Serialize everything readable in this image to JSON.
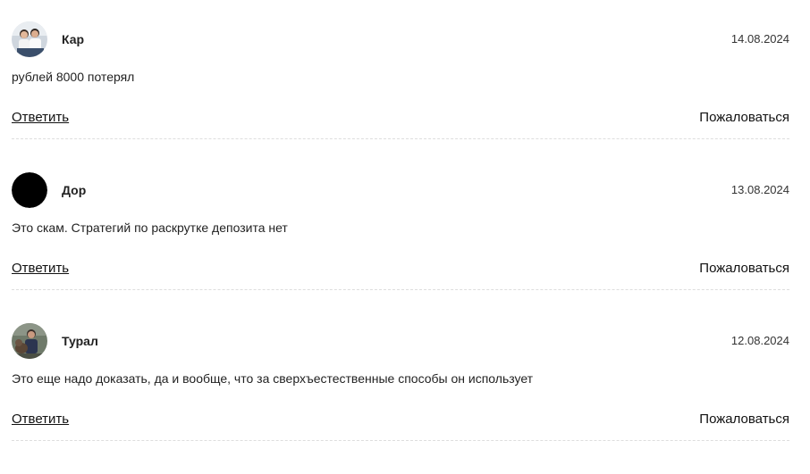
{
  "comments": [
    {
      "author": "Кар",
      "date": "14.08.2024",
      "text": "рублей 8000 потерял",
      "reply_label": "Ответить",
      "report_label": "Пожаловаться",
      "avatar": "photo-avatar-two-people"
    },
    {
      "author": "Дор",
      "date": "13.08.2024",
      "text": "Это скам. Стратегий по раскрутке депозита нет",
      "reply_label": "Ответить",
      "report_label": "Пожаловаться",
      "avatar": "black-circle-avatar"
    },
    {
      "author": "Турал",
      "date": "12.08.2024",
      "text": "Это еще надо доказать, да и вообще, что за сверхъестественные способы он использует",
      "reply_label": "Ответить",
      "report_label": "Пожаловаться",
      "avatar": "photo-avatar-person-with-dog"
    }
  ]
}
